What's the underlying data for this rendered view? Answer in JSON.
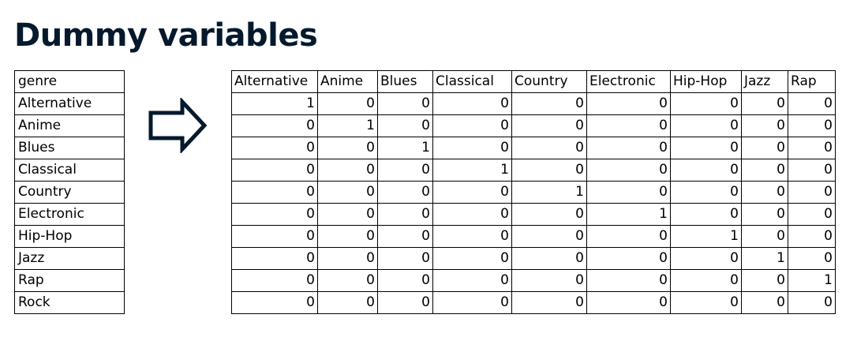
{
  "title": "Dummy variables",
  "genre_table": {
    "header": "genre",
    "rows": [
      "Alternative",
      "Anime",
      "Blues",
      "Classical",
      "Country",
      "Electronic",
      "Hip-Hop",
      "Jazz",
      "Rap",
      "Rock"
    ]
  },
  "arrow_icon": "right-arrow-icon",
  "dummy_table": {
    "columns": [
      "Alternative",
      "Anime",
      "Blues",
      "Classical",
      "Country",
      "Electronic",
      "Hip-Hop",
      "Jazz",
      "Rap"
    ],
    "rows": [
      [
        "1",
        "0",
        "0",
        "0",
        "0",
        "0",
        "0",
        "0",
        "0"
      ],
      [
        "0",
        "1",
        "0",
        "0",
        "0",
        "0",
        "0",
        "0",
        "0"
      ],
      [
        "0",
        "0",
        "1",
        "0",
        "0",
        "0",
        "0",
        "0",
        "0"
      ],
      [
        "0",
        "0",
        "0",
        "1",
        "0",
        "0",
        "0",
        "0",
        "0"
      ],
      [
        "0",
        "0",
        "0",
        "0",
        "1",
        "0",
        "0",
        "0",
        "0"
      ],
      [
        "0",
        "0",
        "0",
        "0",
        "0",
        "1",
        "0",
        "0",
        "0"
      ],
      [
        "0",
        "0",
        "0",
        "0",
        "0",
        "0",
        "1",
        "0",
        "0"
      ],
      [
        "0",
        "0",
        "0",
        "0",
        "0",
        "0",
        "0",
        "1",
        "0"
      ],
      [
        "0",
        "0",
        "0",
        "0",
        "0",
        "0",
        "0",
        "0",
        "1"
      ],
      [
        "0",
        "0",
        "0",
        "0",
        "0",
        "0",
        "0",
        "0",
        "0"
      ]
    ]
  },
  "colors": {
    "title": "#05192d",
    "arrow": "#05192d",
    "border": "#000000"
  }
}
